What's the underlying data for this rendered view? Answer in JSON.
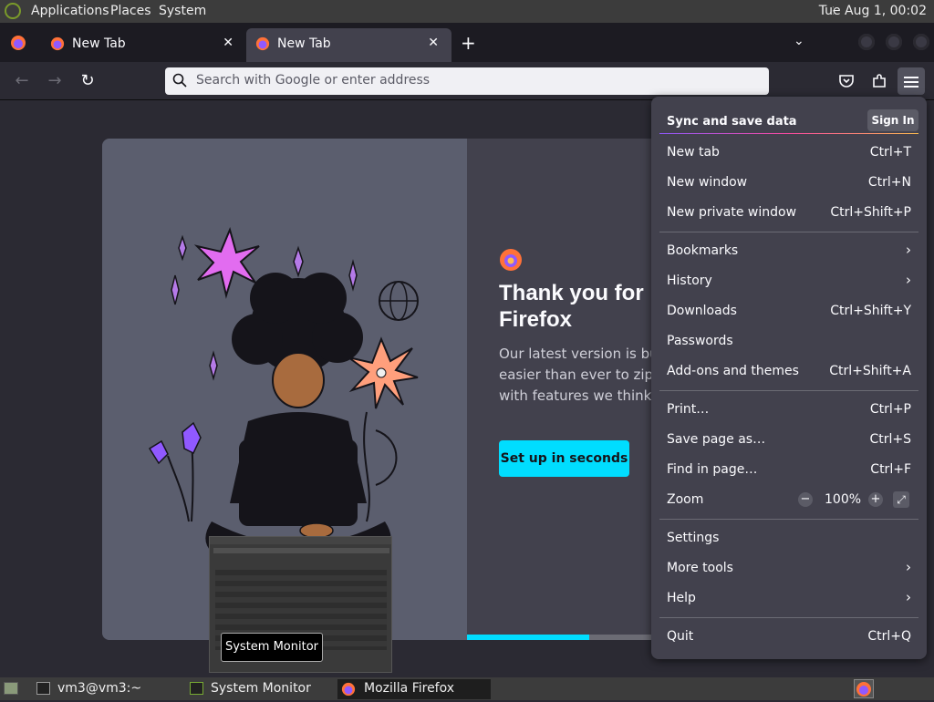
{
  "top_panel": {
    "menus": [
      "Applications",
      "Places",
      "System"
    ],
    "clock": "Tue Aug  1, 00:02"
  },
  "tabs": [
    {
      "label": "New Tab",
      "active": false
    },
    {
      "label": "New Tab",
      "active": true
    }
  ],
  "urlbar": {
    "placeholder": "Search with Google or enter address"
  },
  "welcome": {
    "headline_line1": "Thank you for lo",
    "headline_line2": "Firefox",
    "sub_line1": "Our latest version is built a",
    "sub_line2": "easier than ever to zip aro",
    "sub_line3": "with features we think you",
    "cta": "Set up in seconds",
    "progress": 0.32
  },
  "thumbnail": {
    "tooltip": "System Monitor"
  },
  "app_menu": {
    "sync": {
      "label": "Sync and save data",
      "signin": "Sign In"
    },
    "items": [
      {
        "label": "New tab",
        "shortcut": "Ctrl+T"
      },
      {
        "label": "New window",
        "shortcut": "Ctrl+N"
      },
      {
        "label": "New private window",
        "shortcut": "Ctrl+Shift+P"
      },
      {
        "label": "Bookmarks",
        "shortcut": ">"
      },
      {
        "label": "History",
        "shortcut": ">"
      },
      {
        "label": "Downloads",
        "shortcut": "Ctrl+Shift+Y"
      },
      {
        "label": "Passwords",
        "shortcut": ""
      },
      {
        "label": "Add-ons and themes",
        "shortcut": "Ctrl+Shift+A"
      },
      {
        "label": "Print…",
        "shortcut": "Ctrl+P"
      },
      {
        "label": "Save page as…",
        "shortcut": "Ctrl+S"
      },
      {
        "label": "Find in page…",
        "shortcut": "Ctrl+F"
      },
      {
        "label": "Zoom",
        "shortcut": ""
      },
      {
        "label": "Settings",
        "shortcut": ""
      },
      {
        "label": "More tools",
        "shortcut": ">"
      },
      {
        "label": "Help",
        "shortcut": ">"
      },
      {
        "label": "Quit",
        "shortcut": "Ctrl+Q"
      }
    ],
    "zoom": {
      "minus": "−",
      "value": "100%",
      "plus": "+"
    }
  },
  "taskbar": {
    "tasks": [
      "vm3@vm3:~",
      "System Monitor",
      "Mozilla Firefox"
    ]
  },
  "colors": {
    "accent": "#00ddff",
    "menu_bg": "#42414d",
    "toolbar_bg": "#2b2a33"
  }
}
